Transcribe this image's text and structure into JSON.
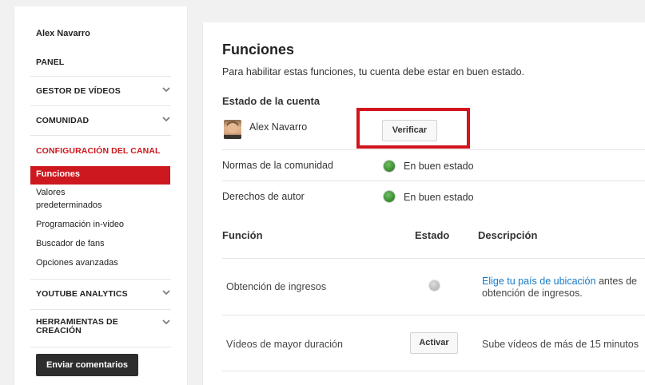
{
  "sidebar": {
    "user_name": "Alex Navarro",
    "panel": "PANEL",
    "gestor": "GESTOR DE VÍDEOS",
    "comunidad": "COMUNIDAD",
    "configuracion": "CONFIGURACIÓN DEL CANAL",
    "items": {
      "funciones": "Funciones",
      "valores_1": "Valores",
      "valores_2": "predeterminados",
      "programacion": "Programación in-video",
      "buscador": "Buscador de fans",
      "opciones": "Opciones avanzadas"
    },
    "analytics": "YOUTUBE ANALYTICS",
    "herramientas_1": "HERRAMIENTAS DE",
    "herramientas_2": "CREACIÓN",
    "feedback": "Enviar comentarios"
  },
  "main": {
    "title": "Funciones",
    "description": "Para habilitar estas funciones, tu cuenta debe estar en buen estado.",
    "account_heading": "Estado de la cuenta",
    "user_name": "Alex Navarro",
    "verify_button": "Verificar",
    "statuses": [
      {
        "label": "Normas de la comunidad",
        "value": "En buen estado"
      },
      {
        "label": "Derechos de autor",
        "value": "En buen estado"
      }
    ],
    "table": {
      "headers": [
        "Función",
        "Estado",
        "Descripción"
      ],
      "rows": [
        {
          "feature": "Obtención de ingresos",
          "desc_link": "Elige tu país de ubicación",
          "desc_rest": " antes de",
          "desc_line2": "obtención de ingresos."
        },
        {
          "feature": "Vídeos de mayor duración",
          "button": "Activar",
          "desc": "Sube vídeos de más de 15 minutos"
        }
      ]
    }
  },
  "colors": {
    "accent_red": "#cc181e",
    "status_green": "#3f8f35",
    "link_blue": "#167ac6",
    "highlight_box": "#d1141d"
  },
  "icons": [
    "chevron-down-icon",
    "status-dot-icon",
    "avatar"
  ]
}
